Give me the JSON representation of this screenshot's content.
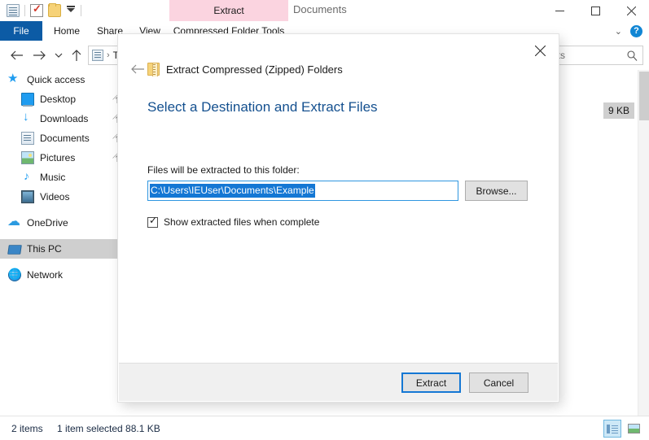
{
  "window": {
    "title": "Documents",
    "quick_access_icons": [
      "save-icon",
      "properties-check-icon",
      "new-folder-icon",
      "customize-caret-icon"
    ],
    "controls": {
      "minimize": "minimize-icon",
      "maximize": "maximize-icon",
      "close": "close-icon"
    }
  },
  "ribbon": {
    "tabs": [
      {
        "label": "File"
      },
      {
        "label": "Home"
      },
      {
        "label": "Share"
      },
      {
        "label": "View"
      },
      {
        "label": "Compressed Folder Tools"
      }
    ],
    "contextual_tab": "Extract",
    "contextual_color": "#fbd4e0",
    "collapse_icon": "chevron-down-icon",
    "help_icon": "help-question-icon"
  },
  "navbar": {
    "back_icon": "arrow-left-icon",
    "forward_icon": "arrow-right-icon",
    "recent_icon": "chevron-down-icon",
    "up_icon": "arrow-up-icon",
    "breadcrumb_icon": "documents-icon",
    "breadcrumb_separator": "›",
    "breadcrumb_text": "T",
    "search_value": "nts",
    "search_icon": "search-icon"
  },
  "sidebar": {
    "items": [
      {
        "label": "Quick access",
        "icon": "star-icon",
        "indent": false,
        "pinned": false,
        "selected": false
      },
      {
        "label": "Desktop",
        "icon": "desktop-icon",
        "indent": true,
        "pinned": true,
        "selected": false
      },
      {
        "label": "Downloads",
        "icon": "downloads-icon",
        "indent": true,
        "pinned": true,
        "selected": false
      },
      {
        "label": "Documents",
        "icon": "documents-icon",
        "indent": true,
        "pinned": true,
        "selected": false
      },
      {
        "label": "Pictures",
        "icon": "pictures-icon",
        "indent": true,
        "pinned": true,
        "selected": false
      },
      {
        "label": "Music",
        "icon": "music-icon",
        "indent": true,
        "pinned": false,
        "selected": false
      },
      {
        "label": "Videos",
        "icon": "videos-icon",
        "indent": true,
        "pinned": false,
        "selected": false
      },
      {
        "label": "OneDrive",
        "icon": "cloud-icon",
        "indent": false,
        "pinned": false,
        "selected": false
      },
      {
        "label": "This PC",
        "icon": "this-pc-icon",
        "indent": false,
        "pinned": false,
        "selected": true
      },
      {
        "label": "Network",
        "icon": "network-icon",
        "indent": false,
        "pinned": false,
        "selected": false
      }
    ],
    "pin_glyph": "📌"
  },
  "filelist": {
    "visible_row_size": "9 KB"
  },
  "statusbar": {
    "item_count": "2 items",
    "selection": "1 item selected  88.1 KB",
    "view_details_icon": "details-view-icon",
    "view_icons_icon": "large-icons-view-icon"
  },
  "dialog": {
    "close_icon": "close-icon",
    "back_icon": "arrow-left-icon",
    "app_icon": "zip-folder-icon",
    "app_title": "Extract Compressed (Zipped) Folders",
    "heading": "Select a Destination and Extract Files",
    "path_label": "Files will be extracted to this folder:",
    "path_value": "C:\\Users\\IEUser\\Documents\\Example",
    "browse_label": "Browse...",
    "checkbox_label": "Show extracted files when complete",
    "checkbox_checked": true,
    "primary_button": "Extract",
    "cancel_button": "Cancel",
    "accent_color": "#1477d4",
    "heading_color": "#14508f"
  }
}
